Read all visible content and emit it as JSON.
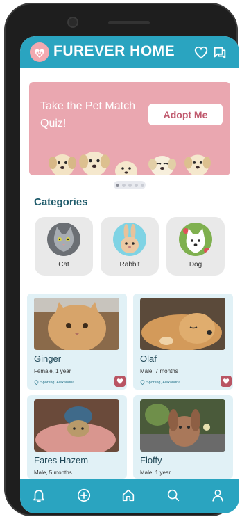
{
  "header": {
    "title": "FUREVER HOME",
    "icons": [
      "paw-logo-icon",
      "heart-icon",
      "chat-icon"
    ]
  },
  "banner": {
    "text": "Take the Pet Match Quiz!",
    "button_label": "Adopt Me"
  },
  "carousel": {
    "pages": 5,
    "active": 1
  },
  "categories": {
    "title": "Categories",
    "items": [
      {
        "label": "Cat"
      },
      {
        "label": "Rabbit"
      },
      {
        "label": "Dog"
      }
    ]
  },
  "pets": [
    {
      "name": "Ginger",
      "info": "Female, 1 year",
      "location": "Sporting, Alexandria"
    },
    {
      "name": "Olaf",
      "info": "Male, 7 months",
      "location": "Sporting, Alexandria"
    },
    {
      "name": "Fares Hazem",
      "info": "Male, 5 months"
    },
    {
      "name": "Floffy",
      "info": "Male, 1 year"
    }
  ],
  "bottom_nav": [
    "bell-icon",
    "add-icon",
    "home-icon",
    "search-icon",
    "profile-icon"
  ],
  "colors": {
    "primary": "#2aa4c0",
    "banner": "#eaa7b0",
    "card": "#e1f1f6",
    "accent": "#b95563",
    "heading": "#1f5b6b"
  }
}
